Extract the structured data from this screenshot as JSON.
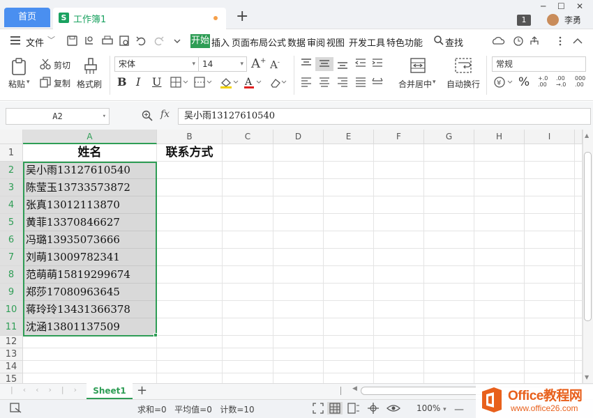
{
  "titlebar": {
    "home_tab": "首页",
    "doc_tab": "工作簿1",
    "doc_icon": "S",
    "new_tab": "+",
    "badge": "1",
    "user": "李勇",
    "min": "─",
    "max": "☐",
    "close": "✕"
  },
  "menu": {
    "file": "文件",
    "items": [
      "开始",
      "插入",
      "页面布局",
      "公式",
      "数据",
      "审阅",
      "视图",
      "开发工具",
      "特色功能"
    ],
    "search": "查找"
  },
  "ribbon": {
    "paste": "粘贴",
    "cut": "剪切",
    "copy": "复制",
    "format_painter": "格式刷",
    "font_name": "宋体",
    "font_size": "14",
    "merge_center": "合并居中",
    "auto_wrap": "自动换行",
    "number_format": "常规",
    "percent": "%"
  },
  "formula_bar": {
    "name_box": "A2",
    "fx": "fx",
    "value": "吴小雨13127610540"
  },
  "grid": {
    "columns": [
      "A",
      "B",
      "C",
      "D",
      "E",
      "F",
      "G",
      "H",
      "I"
    ],
    "rows": [
      "1",
      "2",
      "3",
      "4",
      "5",
      "6",
      "7",
      "8",
      "9",
      "10",
      "11",
      "12",
      "13",
      "14",
      "15"
    ],
    "A1": "姓名",
    "B1": "联系方式",
    "col_a": [
      "吴小雨13127610540",
      "陈莹玉13733573872",
      "张真13012113870",
      "黄菲13370846627",
      "冯璐13935073666",
      "刘萌13009782341",
      "范萌萌15819299674",
      "郑莎17080963645",
      "蒋玲玲13431366378",
      "沈涵13801137509"
    ]
  },
  "sheet": {
    "tab": "Sheet1",
    "add": "+"
  },
  "status": {
    "sum": "求和=0",
    "avg": "平均值=0",
    "count": "计数=10",
    "zoom": "100%"
  },
  "watermark": {
    "line1": "Office教程网",
    "line2": "www.office26.com"
  },
  "colors": {
    "accent_green": "#2e9d55",
    "tab_blue": "#4a8ff0",
    "logo_orange": "#e8601c"
  }
}
